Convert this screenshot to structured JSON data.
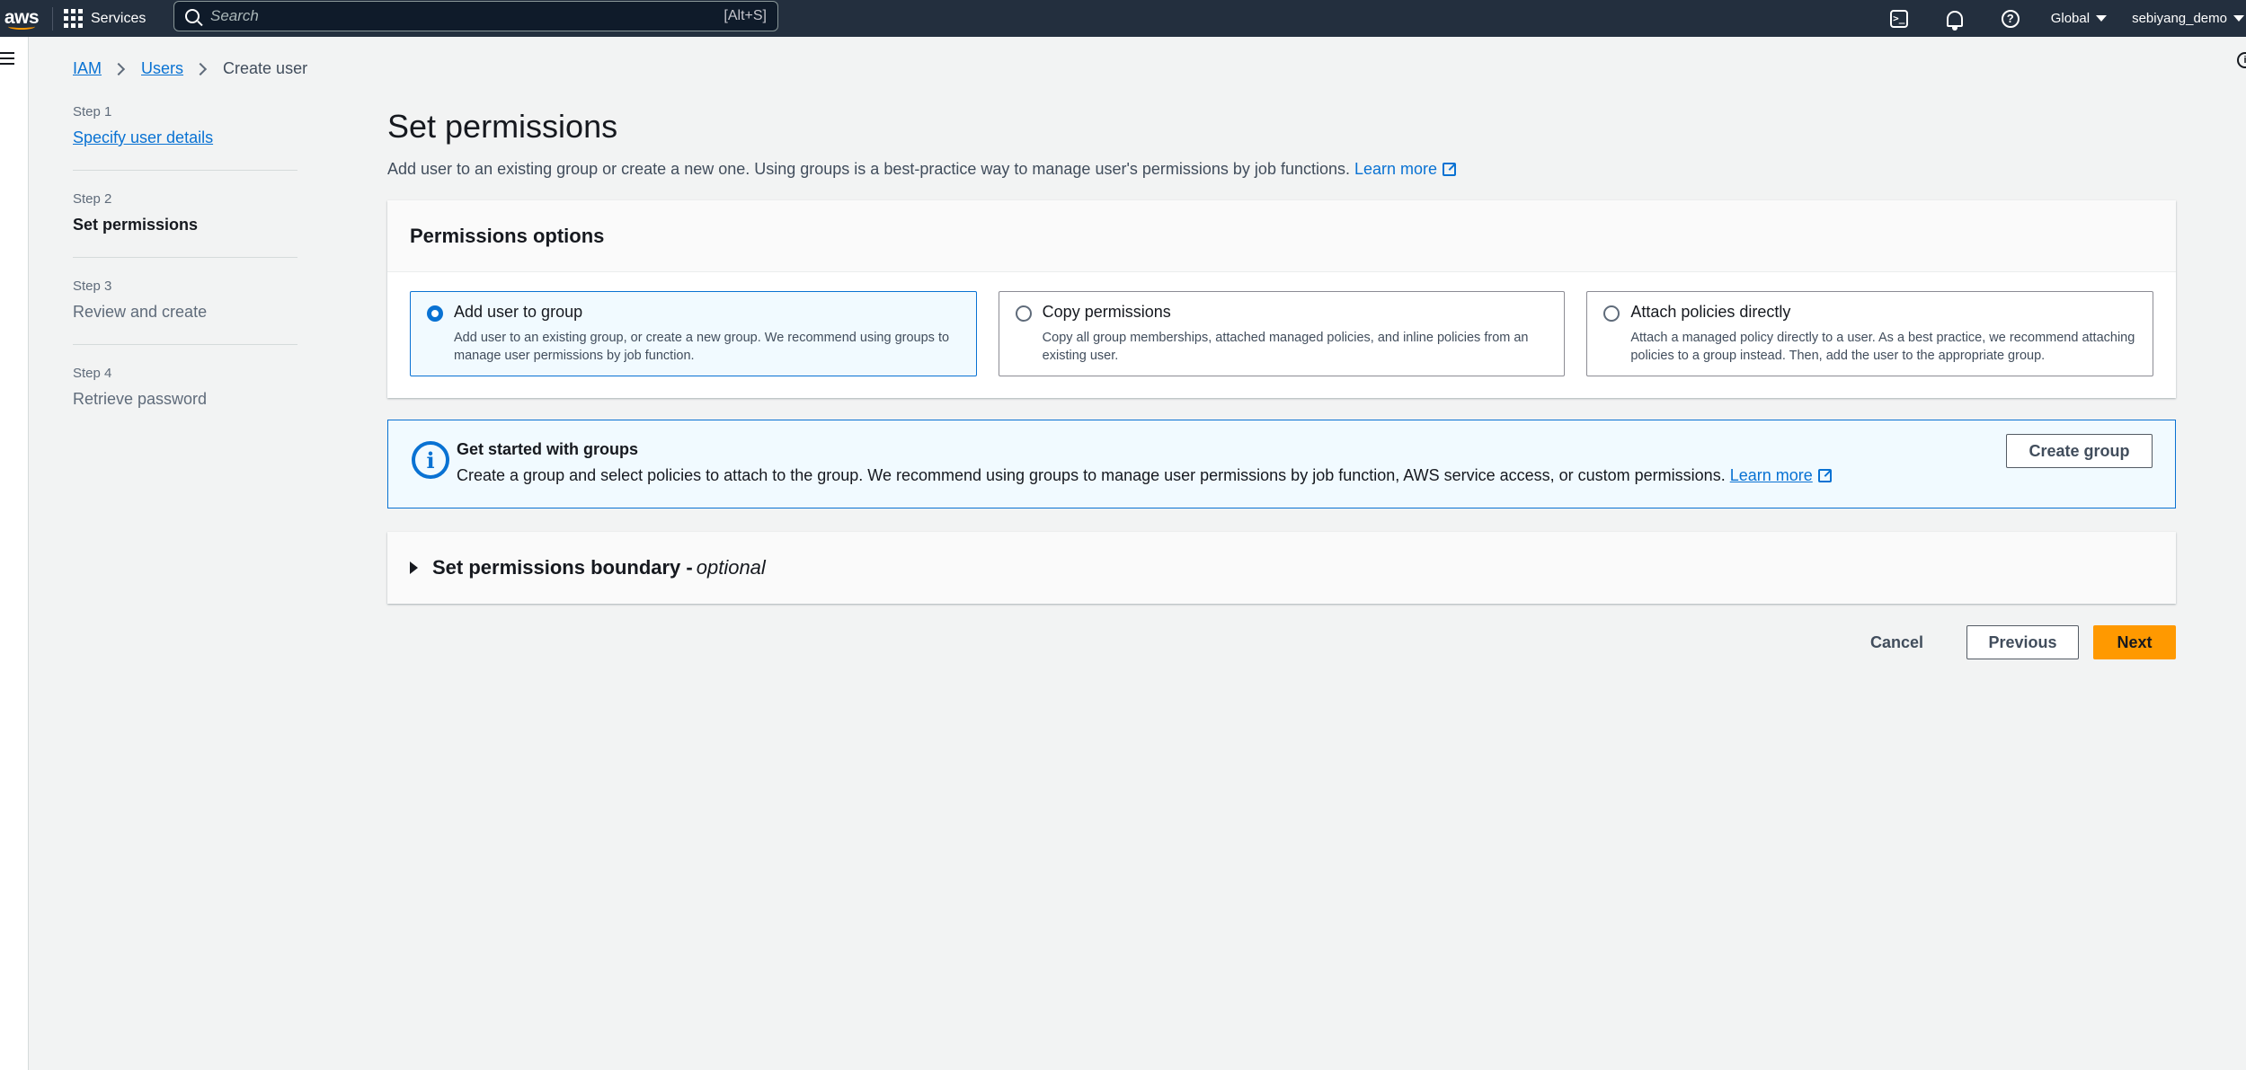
{
  "nav": {
    "logo": "aws",
    "services_label": "Services",
    "search_placeholder": "Search",
    "search_shortcut": "[Alt+S]",
    "region": "Global",
    "user": "sebiyang_demo",
    "icons": [
      "cloudshell-icon",
      "notifications-icon",
      "help-icon"
    ]
  },
  "breadcrumb": {
    "items": [
      "IAM",
      "Users"
    ],
    "current": "Create user"
  },
  "steps": [
    {
      "num": "Step 1",
      "label": "Specify user details",
      "state": "link"
    },
    {
      "num": "Step 2",
      "label": "Set permissions",
      "state": "active"
    },
    {
      "num": "Step 3",
      "label": "Review and create",
      "state": "disabled"
    },
    {
      "num": "Step 4",
      "label": "Retrieve password",
      "state": "disabled"
    }
  ],
  "main": {
    "title": "Set permissions",
    "description": "Add user to an existing group or create a new one. Using groups is a best-practice way to manage user's permissions by job functions.",
    "learn_more": "Learn more"
  },
  "permissions": {
    "header": "Permissions options",
    "options": [
      {
        "title": "Add user to group",
        "desc": "Add user to an existing group, or create a new group. We recommend using groups to manage user permissions by job function.",
        "selected": true
      },
      {
        "title": "Copy permissions",
        "desc": "Copy all group memberships, attached managed policies, and inline policies from an existing user.",
        "selected": false
      },
      {
        "title": "Attach policies directly",
        "desc": "Attach a managed policy directly to a user. As a best practice, we recommend attaching policies to a group instead. Then, add the user to the appropriate group.",
        "selected": false
      }
    ]
  },
  "alert": {
    "title": "Get started with groups",
    "body": "Create a group and select policies to attach to the group. We recommend using groups to manage user permissions by job function, AWS service access, or custom permissions.",
    "learn_more": "Learn more",
    "button": "Create group"
  },
  "boundary": {
    "title": "Set permissions boundary - ",
    "optional": "optional"
  },
  "actions": {
    "cancel": "Cancel",
    "previous": "Previous",
    "next": "Next"
  },
  "colors": {
    "nav_bg": "#232f3e",
    "accent": "#0972d3",
    "primary_button": "#ff9900",
    "page_bg": "#f2f3f3"
  }
}
